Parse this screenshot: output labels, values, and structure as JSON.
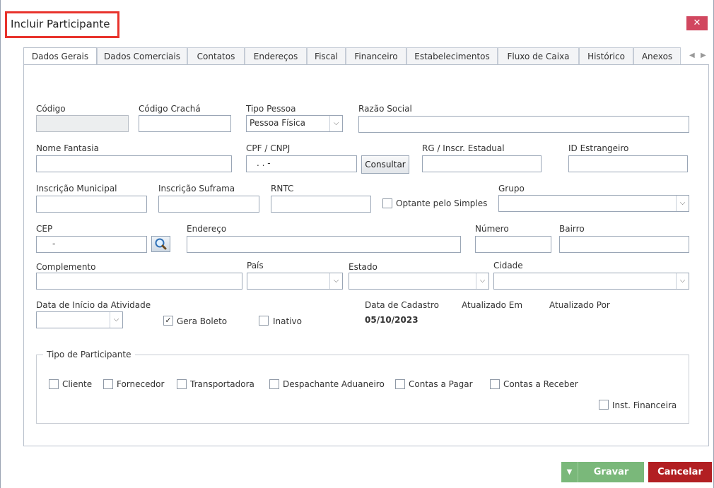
{
  "window": {
    "title": "Incluir Participante",
    "close": "✕"
  },
  "tabs": [
    {
      "label": "Dados Gerais"
    },
    {
      "label": "Dados Comerciais"
    },
    {
      "label": "Contatos"
    },
    {
      "label": "Endereços"
    },
    {
      "label": "Fiscal"
    },
    {
      "label": "Financeiro"
    },
    {
      "label": "Estabelecimentos"
    },
    {
      "label": "Fluxo de Caixa"
    },
    {
      "label": "Histórico"
    },
    {
      "label": "Anexos"
    }
  ],
  "tab_nav": {
    "prev": "◀",
    "next": "▶"
  },
  "form": {
    "codigo": {
      "label": "Código",
      "value": ""
    },
    "codigo_cracha": {
      "label": "Código Crachá",
      "value": ""
    },
    "tipo_pessoa": {
      "label": "Tipo Pessoa",
      "value": "Pessoa Física"
    },
    "razao_social": {
      "label": "Razão Social",
      "value": ""
    },
    "nome_fantasia": {
      "label": "Nome Fantasia",
      "value": ""
    },
    "cpf_cnpj": {
      "label": "CPF / CNPJ",
      "value": ".   .   -"
    },
    "consultar": "Consultar",
    "rg": {
      "label": "RG / Inscr. Estadual",
      "value": ""
    },
    "id_estrangeiro": {
      "label": "ID Estrangeiro",
      "value": ""
    },
    "inscricao_municipal": {
      "label": "Inscrição Municipal",
      "value": ""
    },
    "inscricao_suframa": {
      "label": "Inscrição Suframa",
      "value": ""
    },
    "rntc": {
      "label": "RNTC",
      "value": ""
    },
    "optante_simples": {
      "label": "Optante pelo Simples",
      "checked": false
    },
    "grupo": {
      "label": "Grupo",
      "value": ""
    },
    "cep": {
      "label": "CEP",
      "value": "-"
    },
    "endereco": {
      "label": "Endereço",
      "value": ""
    },
    "numero": {
      "label": "Número",
      "value": ""
    },
    "bairro": {
      "label": "Bairro",
      "value": ""
    },
    "complemento": {
      "label": "Complemento",
      "value": ""
    },
    "pais": {
      "label": "País",
      "value": ""
    },
    "estado": {
      "label": "Estado",
      "value": ""
    },
    "cidade": {
      "label": "Cidade",
      "value": ""
    },
    "data_inicio": {
      "label": "Data de Início da Atividade",
      "value": ""
    },
    "gera_boleto": {
      "label": "Gera Boleto",
      "checked": true,
      "mark": "✓"
    },
    "inativo": {
      "label": "Inativo",
      "checked": false
    },
    "data_cadastro": {
      "label": "Data de Cadastro",
      "value": "05/10/2023"
    },
    "atualizado_em": {
      "label": "Atualizado Em",
      "value": ""
    },
    "atualizado_por": {
      "label": "Atualizado Por",
      "value": ""
    }
  },
  "tipo_participante": {
    "legend": "Tipo de Participante",
    "options": [
      {
        "label": "Cliente",
        "checked": false
      },
      {
        "label": "Fornecedor",
        "checked": false
      },
      {
        "label": "Transportadora",
        "checked": false
      },
      {
        "label": "Despachante Aduaneiro",
        "checked": false
      },
      {
        "label": "Contas a Pagar",
        "checked": false
      },
      {
        "label": "Contas a Receber",
        "checked": false
      },
      {
        "label": "Inst. Financeira",
        "checked": false
      }
    ]
  },
  "footer": {
    "gravar": "Gravar",
    "gravar_dropdown": "▼",
    "cancelar": "Cancelar"
  },
  "icons": {
    "select_arrow": "⌵",
    "search": "magnifier-icon"
  },
  "colors": {
    "title_highlight": "#e8332c",
    "close_bg": "#d1475f",
    "gravar_bg": "#7ab87a",
    "cancelar_bg": "#b21f22"
  }
}
